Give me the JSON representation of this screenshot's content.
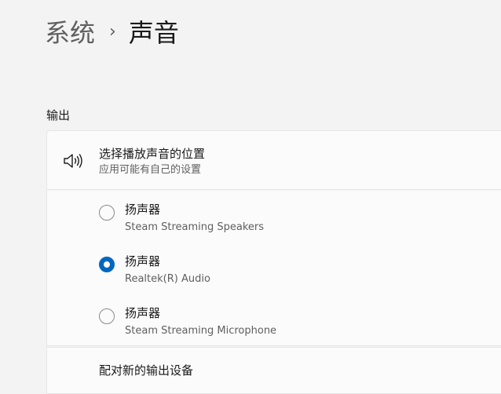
{
  "breadcrumb": {
    "parent": "系统",
    "separator": "›",
    "current": "声音"
  },
  "output": {
    "section_title": "输出",
    "header": {
      "icon": "speaker-icon",
      "title": "选择播放声音的位置",
      "subtitle": "应用可能有自己的设置"
    },
    "devices": [
      {
        "name": "扬声器",
        "description": "Steam Streaming Speakers",
        "selected": false
      },
      {
        "name": "扬声器",
        "description": "Realtek(R) Audio",
        "selected": true
      },
      {
        "name": "扬声器",
        "description": "Steam Streaming Microphone",
        "selected": false
      }
    ],
    "pair_new_device_label": "配对新的输出设备"
  },
  "colors": {
    "accent": "#0067c0",
    "background": "#f3f3f3",
    "card": "#fbfbfb"
  }
}
